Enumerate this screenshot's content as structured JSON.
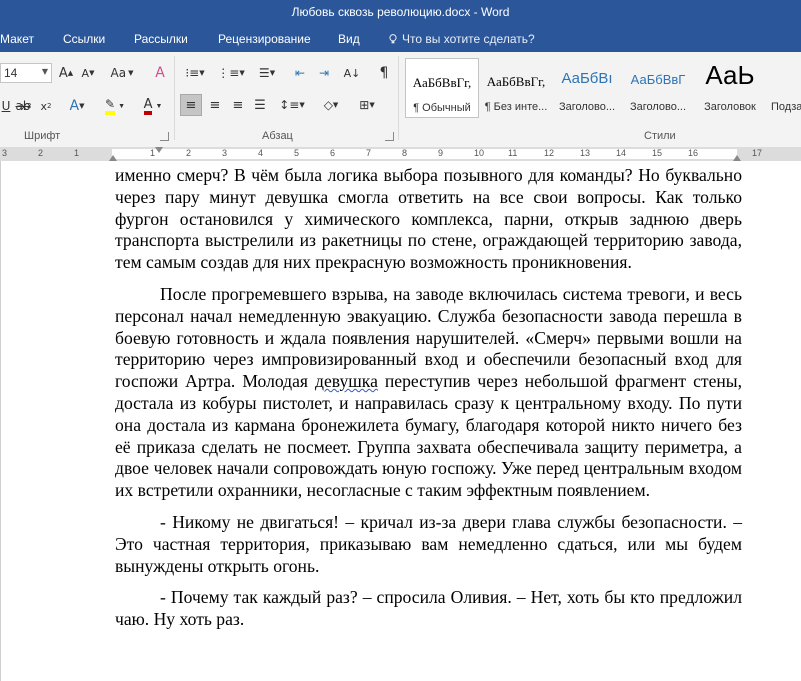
{
  "window": {
    "title": "Любовь сквозь революцию.docx - Word"
  },
  "tabs": [
    "Макет",
    "Ссылки",
    "Рассылки",
    "Рецензирование",
    "Вид"
  ],
  "tell_me": "Что вы хотите сделать?",
  "font": {
    "size": "14",
    "group_label": "Шрифт"
  },
  "paragraph": {
    "group_label": "Абзац"
  },
  "styles": {
    "group_label": "Стили",
    "items": [
      {
        "sample": "АаБбВвГг,",
        "name": "¶ Обычный"
      },
      {
        "sample": "АаБбВвГг,",
        "name": "¶ Без инте..."
      },
      {
        "sample": "АаБбВı",
        "name": "Заголово..."
      },
      {
        "sample": "АаБбВвГ",
        "name": "Заголово..."
      },
      {
        "sample": "АаЬ",
        "name": "Заголовок"
      },
      {
        "sample": "",
        "name": "Подза"
      }
    ]
  },
  "colors": {
    "ribbon_blue": "#2b579a",
    "heading_blue": "#2e74b5",
    "highlight_yellow": "#ffff00",
    "font_red": "#c00000"
  },
  "ruler": {
    "numbers": [
      "3",
      "2",
      "1",
      "1",
      "2",
      "3",
      "4",
      "5",
      "6",
      "7",
      "8",
      "9",
      "10",
      "11",
      "12",
      "13",
      "14",
      "15",
      "16",
      "17"
    ]
  },
  "document": {
    "p1": "именно смерч? В чём была логика выбора позывного для команды? Но буквально через пару минут девушка смогла ответить на все свои вопросы. Как только фургон остановился у химического комплекса, парни, открыв заднюю дверь транспорта выстрелили из ракетницы по стене, ограждающей территорию завода, тем самым создав для них прекрасную возможность проникновения.",
    "p2_a": "После прогремевшего взрыва, на заводе включилась система тревоги, и весь персонал начал немедленную эвакуацию. Служба безопасности завода перешла в боевую готовность и ждала появления нарушителей. «Смерч» первыми вошли на территорию через импровизированный вход и обеспечили безопасный вход для госпожи Артра. Молодая ",
    "p2_word": "девушка",
    "p2_b": " переступив через небольшой фрагмент стены, достала из кобуры пистолет, и направилась сразу к центральному входу. По пути она достала из кармана бронежилета бумагу, благодаря которой никто ничего без её приказа сделать не посмеет. Группа захвата обеспечивала защиту периметра, а двое человек начали сопровождать юную госпожу. Уже перед центральным входом их встретили охранники, несогласные с таким эффектным появлением.",
    "p3": "- Никому не двигаться! – кричал из-за двери глава службы безопасности. – Это частная территория, приказываю вам немедленно сдаться, или мы будем вынуждены открыть огонь.",
    "p4": "- Почему так каждый раз? – спросила Оливия. – Нет, хоть бы кто предложил чаю. Ну хоть раз."
  }
}
